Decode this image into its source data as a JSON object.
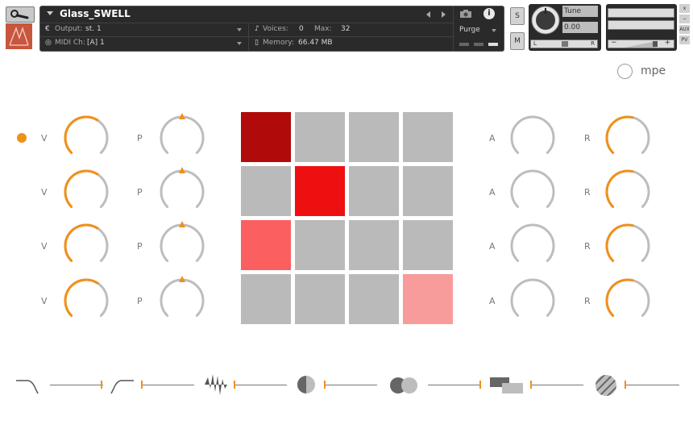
{
  "header": {
    "instrument_name": "Glass_SWELL",
    "output_label": "Output:",
    "output_value": "st. 1",
    "voices_label": "Voices:",
    "voices_value": "0",
    "max_label": "Max:",
    "max_value": "32",
    "purge_label": "Purge",
    "midi_label": "MIDI Ch:",
    "midi_value": "[A]  1",
    "memory_label": "Memory:",
    "memory_value": "66.47 MB",
    "solo_label": "S",
    "mute_label": "M",
    "tune_label": "Tune",
    "tune_value": "0.00",
    "pan_left": "L",
    "pan_right": "R",
    "meter_minus": "−",
    "meter_plus": "+",
    "side_close": "x",
    "side_minimize": "−",
    "side_aux": "AUX",
    "side_pv": "PV"
  },
  "mpe": {
    "label": "mpe",
    "enabled": false
  },
  "labels": {
    "v": "V",
    "p": "P",
    "a": "A",
    "r": "R"
  },
  "accent_color": "#f0901a",
  "knob_track_color": "#bdbdbd",
  "rows": [
    {
      "v": 0.62,
      "p": 0.5,
      "a": 0.0,
      "r": 0.55,
      "active": true
    },
    {
      "v": 0.62,
      "p": 0.5,
      "a": 0.0,
      "r": 0.55,
      "active": false
    },
    {
      "v": 0.62,
      "p": 0.5,
      "a": 0.0,
      "r": 0.55,
      "active": false
    },
    {
      "v": 0.62,
      "p": 0.5,
      "a": 0.0,
      "r": 0.55,
      "active": false
    }
  ],
  "grid": {
    "cells": [
      [
        "#b00a0a",
        "#bababa",
        "#bababa",
        "#bababa"
      ],
      [
        "#bababa",
        "#ee1010",
        "#bababa",
        "#bababa"
      ],
      [
        "#fb5f5f",
        "#bababa",
        "#bababa",
        "#bababa"
      ],
      [
        "#bababa",
        "#bababa",
        "#bababa",
        "#f89b9b"
      ]
    ]
  },
  "effects": [
    {
      "name": "lowpass-filter-icon"
    },
    {
      "name": "highpass-filter-icon"
    },
    {
      "name": "distortion-icon"
    },
    {
      "name": "phaser-icon"
    },
    {
      "name": "chorus-icon"
    },
    {
      "name": "delay-icon"
    },
    {
      "name": "reverb-icon"
    }
  ]
}
